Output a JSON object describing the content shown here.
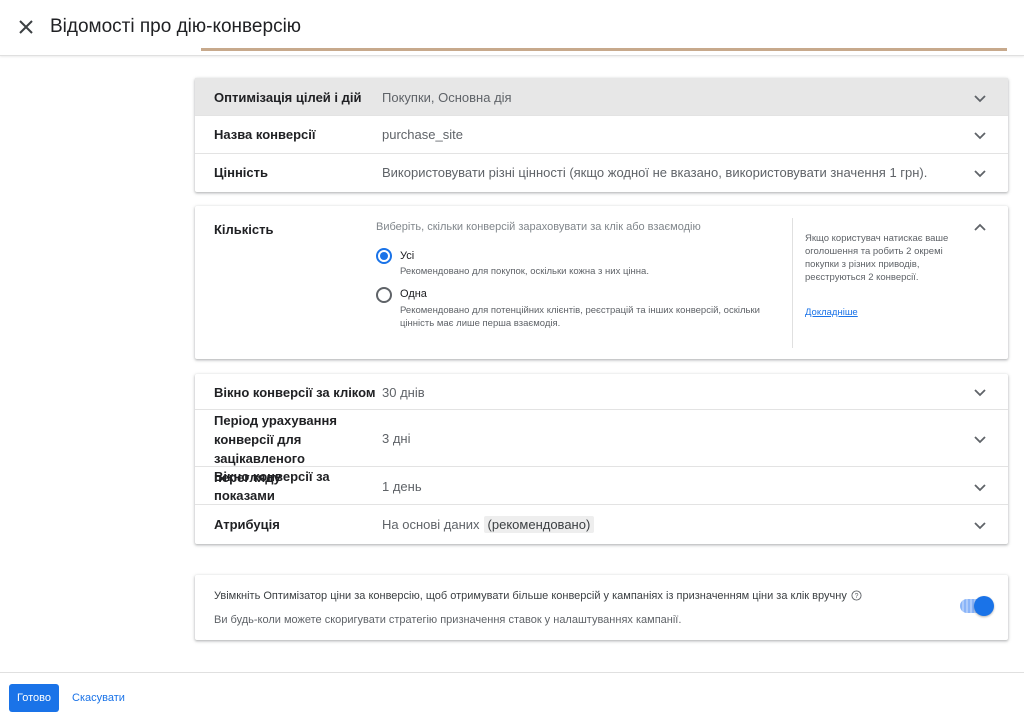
{
  "header": {
    "title": "Відомості про дію-конверсію"
  },
  "rows_top": [
    {
      "label": "Оптимізація цілей і дій",
      "value": "Покупки, Основна дія"
    },
    {
      "label": "Назва конверсії",
      "value": "purchase_site"
    },
    {
      "label": "Цінність",
      "value": "Використовувати різні цінності (якщо жодної не вказано, використовувати значення 1 грн)."
    }
  ],
  "quantity": {
    "label": "Кількість",
    "prompt": "Виберіть, скільки конверсій зараховувати за клік або взаємодію",
    "options": [
      {
        "title": "Усі",
        "desc": "Рекомендовано для покупок, оскільки кожна з них цінна.",
        "selected": true
      },
      {
        "title": "Одна",
        "desc": "Рекомендовано для потенційних клієнтів, реєстрацій та інших конверсій, оскільки цінність має лише перша взаємодія.",
        "selected": false
      }
    ],
    "help": "Якщо користувач натискає ваше оголошення та робить 2 окремі покупки з різних приводів, реєструються 2 конверсії.",
    "learn_more": "Докладніше"
  },
  "rows_bottom": [
    {
      "label": "Вікно конверсії за кліком",
      "value": "30 днів"
    },
    {
      "label": "Період урахування конверсії для зацікавленого перегляду",
      "value": "3 дні"
    },
    {
      "label": "Вікно конверсії за показами",
      "value": "1 день"
    },
    {
      "label": "Атрибуція",
      "value": "На основі даних",
      "badge": "(рекомендовано)"
    }
  ],
  "promo": {
    "line1": "Увімкніть Оптимізатор ціни за конверсію, щоб отримувати більше конверсій у кампаніях із призначенням ціни за клік вручну",
    "line2": "Ви будь-коли можете скоригувати стратегію призначення ставок у налаштуваннях кампанії.",
    "toggle_on": true
  },
  "footer": {
    "done": "Готово",
    "cancel": "Скасувати"
  },
  "colors": {
    "accent": "#1a73e8",
    "highlight_row": "#e7e7e7"
  }
}
